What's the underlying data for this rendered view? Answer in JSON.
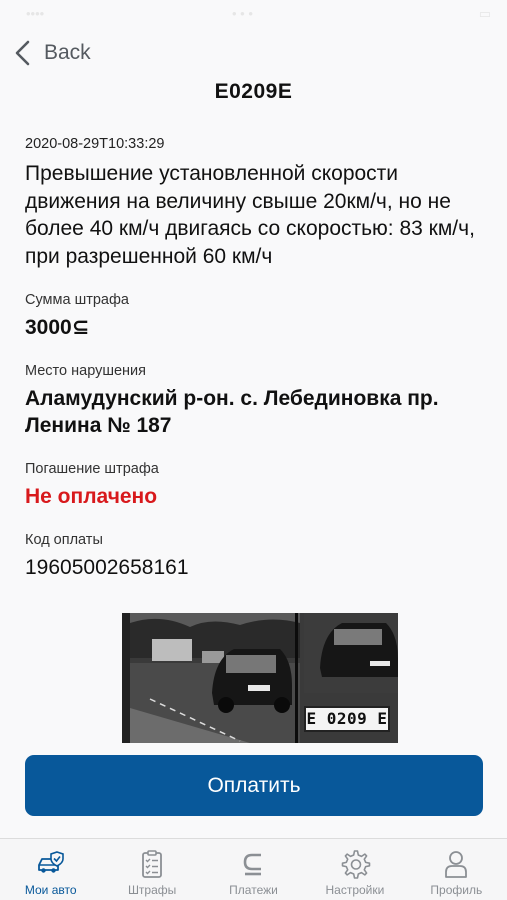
{
  "nav": {
    "back_label": "Back"
  },
  "plate": "E0209E",
  "violation": {
    "datetime": "2020-08-29T10:33:29",
    "description": "Превышение установленной скорости движения на величину свыше 20км/ч, но не более 40 км/ч двигаясь со скоростью: 83 км/ч, при разрешенной 60 км/ч"
  },
  "fields": {
    "fine_label": "Сумма штрафа",
    "fine_value": "3000⊆",
    "place_label": "Место нарушения",
    "place_value": "Аламудунский р-он. с. Лебединовка пр. Ленина № 187",
    "status_label": "Погашение штрафа",
    "status_value": "Не оплачено",
    "code_label": "Код оплаты",
    "code_value": "19605002658161"
  },
  "photo": {
    "plate_text": "E 0209 E"
  },
  "pay_button": "Оплатить",
  "tabs": [
    {
      "label": "Мои авто",
      "icon": "car-shield-icon",
      "active": true
    },
    {
      "label": "Штрафы",
      "icon": "clipboard-checklist-icon",
      "active": false
    },
    {
      "label": "Платежи",
      "icon": "currency-som-icon",
      "active": false
    },
    {
      "label": "Настройки",
      "icon": "gear-icon",
      "active": false
    },
    {
      "label": "Профиль",
      "icon": "person-icon",
      "active": false
    }
  ],
  "colors": {
    "accent": "#08589a",
    "unpaid": "#d8191c",
    "tab_inactive": "#8b8f94"
  }
}
